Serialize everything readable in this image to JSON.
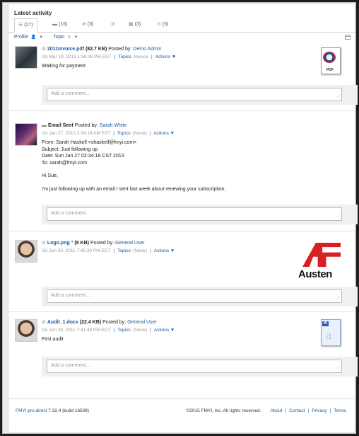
{
  "header": {
    "title": "Latest activity"
  },
  "tabs": [
    {
      "icon": "list-icon",
      "count": "(27)"
    },
    {
      "icon": "comment-icon",
      "count": "(16)"
    },
    {
      "icon": "paperclip-icon",
      "count": "(3)"
    },
    {
      "icon": "link-icon",
      "count": ""
    },
    {
      "icon": "calendar-icon",
      "count": "(3)"
    },
    {
      "icon": "check-circle-icon",
      "count": "(5)"
    }
  ],
  "filters": {
    "profile": "Profile",
    "topic": "Topic"
  },
  "feed": [
    {
      "file_name": "2011Invoice.pdf",
      "size": "(82.7 KB)",
      "posted_by_label": "Posted by:",
      "author": "Demo Admin",
      "date": "On Mar 19, 2013 1:59:28 PM EDT",
      "topics_label": "Topics:",
      "topics_value": "Invoice",
      "actions": "Actions",
      "text": "Waiting for payment",
      "comment_placeholder": "Add a comment...",
      "thumb_label": "PDF"
    },
    {
      "title": "Email Sent",
      "posted_by_label": "Posted by:",
      "author": "Sarah White",
      "date": "On Jan 27, 2013 3:34:18 AM EST",
      "topics_label": "Topics:",
      "topics_value": "(None)",
      "actions": "Actions",
      "email_from": "From: Sarah Haskell <shaskell@fmyi.com>",
      "email_subject": "Subject: Just following up",
      "email_date": "Date: Sun Jan 27 02:34:18 CST 2013",
      "email_to": "To: sarah@fmyi.com",
      "greeting": "Hi Sue,",
      "message": "I'm just following up with an email I sent last week about renewing your subscription.",
      "comment_placeholder": "Add a comment..."
    },
    {
      "file_name": "Logo.png",
      "marker": " * ",
      "size": "(8 KB)",
      "posted_by_label": "Posted by:",
      "author": "General User",
      "date": "On Jun 28, 2011 7:45:30 PM EDT",
      "topics_label": "Topics:",
      "topics_value": "(None)",
      "actions": "Actions",
      "comment_placeholder": "Add a comment...",
      "logo_word": "Austen"
    },
    {
      "file_name": "Audit_1.docx",
      "size": "(22.4 KB)",
      "posted_by_label": "Posted by:",
      "author": "General User",
      "date": "On Jun 28, 2011 7:41:49 PM EDT",
      "topics_label": "Topics:",
      "topics_value": "(None)",
      "actions": "Actions",
      "text": "First audit",
      "comment_placeholder": "Add a comment..."
    }
  ],
  "footer": {
    "product": "FMYI pro direct",
    "version": "7.32.4 (build 16508)",
    "copyright": "©2015 FMYI, Inc. All rights reserved.",
    "links": [
      "About",
      "Contact",
      "Privacy",
      "Terms"
    ]
  },
  "colors": {
    "link": "#1c5aa0",
    "logo_red": "#d82024",
    "background": "#1e1e1e"
  }
}
